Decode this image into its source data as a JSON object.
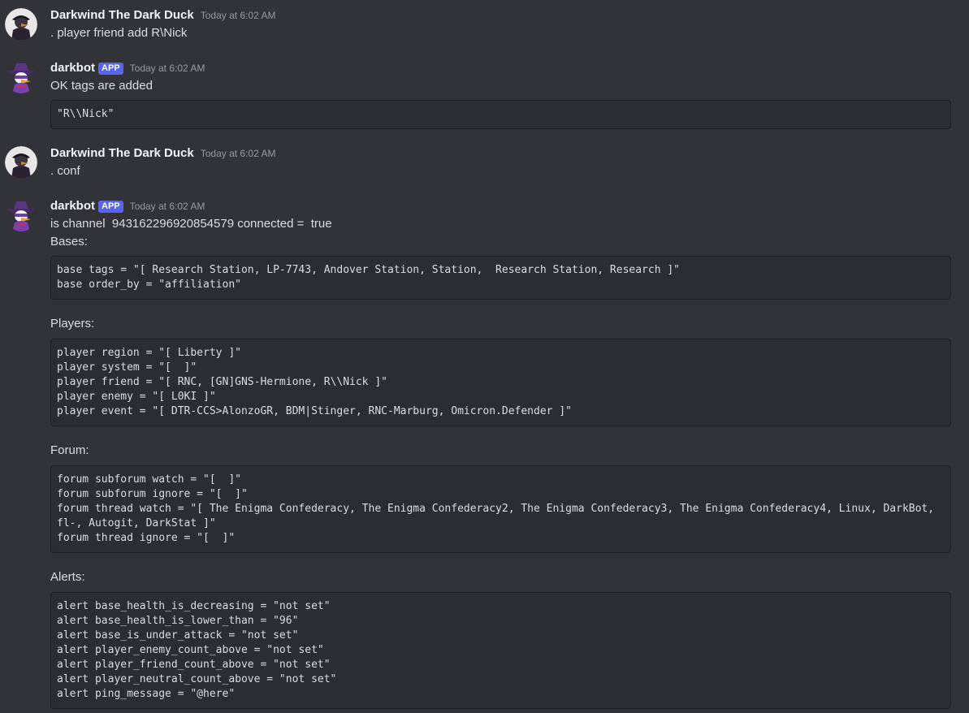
{
  "messages": [
    {
      "author": "Darkwind The Dark Duck",
      "timestamp": "Today at 6:02 AM",
      "text": ". player friend add R\\Nick"
    },
    {
      "author": "darkbot",
      "badge": "APP",
      "timestamp": "Today at 6:02 AM",
      "text": "OK tags are added",
      "code": [
        "\"R\\\\Nick\""
      ]
    },
    {
      "author": "Darkwind The Dark Duck",
      "timestamp": "Today at 6:02 AM",
      "text": ". conf"
    },
    {
      "author": "darkbot",
      "badge": "APP",
      "timestamp": "Today at 6:02 AM",
      "text": "is channel  943162296920854579 connected =  true",
      "sections": [
        {
          "label": "Bases:",
          "code": [
            "base tags = \"[ Research Station, LP-7743, Andover Station, Station,  Research Station, Research ]\"",
            "base order_by = \"affiliation\""
          ]
        },
        {
          "label": "Players:",
          "code": [
            "player region = \"[ Liberty ]\"",
            "player system = \"[  ]\"",
            "player friend = \"[ RNC, [GN]GNS-Hermione, R\\\\Nick ]\"",
            "player enemy = \"[ L0KI ]\"",
            "player event = \"[ DTR-CCS>AlonzoGR, BDM|Stinger, RNC-Marburg, Omicron.Defender ]\""
          ]
        },
        {
          "label": "Forum:",
          "code": [
            "forum subforum watch = \"[  ]\"",
            "forum subforum ignore = \"[  ]\"",
            "forum thread watch = \"[ The Enigma Confederacy, The Enigma Confederacy2, The Enigma Confederacy3, The Enigma Confederacy4, Linux, DarkBot, fl-, Autogit, DarkStat ]\"",
            "forum thread ignore = \"[  ]\""
          ]
        },
        {
          "label": "Alerts:",
          "code": [
            "alert base_health_is_decreasing = \"not set\"",
            "alert base_health_is_lower_than = \"96\"",
            "alert base_is_under_attack = \"not set\"",
            "alert player_enemy_count_above = \"not set\"",
            "alert player_friend_count_above = \"not set\"",
            "alert player_neutral_count_above = \"not set\"",
            "alert ping_message = \"@here\""
          ]
        }
      ]
    }
  ],
  "icons": {
    "user_avatar": "duck-avatar-icon",
    "bot_avatar": "darkwing-duck-avatar-icon"
  },
  "colors": {
    "background": "#313338",
    "code_background": "#2b2d31",
    "badge": "#5865f2",
    "username": "#f2f3f5",
    "timestamp": "#949ba4",
    "text": "#dbdee1"
  }
}
